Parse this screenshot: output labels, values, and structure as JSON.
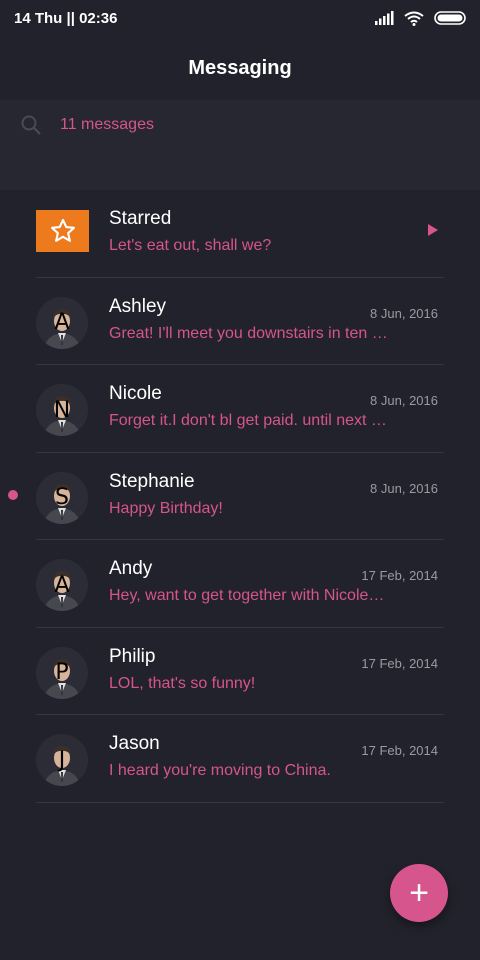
{
  "status_bar": {
    "time_text": "14 Thu || 02:36",
    "icons": [
      "signal-icon",
      "wifi-icon",
      "battery-icon"
    ]
  },
  "header": {
    "title": "Messaging"
  },
  "search": {
    "text": "11 messages",
    "icon": "search-icon"
  },
  "starred": {
    "name": "Starred",
    "preview": "Let's eat out, shall we?",
    "icon": "star-icon"
  },
  "conversations": [
    {
      "letter": "A",
      "name": "Ashley",
      "date": "8 Jun, 2016",
      "preview": "Great! I'll meet you downstairs in ten …",
      "unread": false
    },
    {
      "letter": "N",
      "name": "Nicole",
      "date": "8 Jun, 2016",
      "preview": "Forget it.I don't bl get paid. until next …",
      "unread": false
    },
    {
      "letter": "S",
      "name": "Stephanie",
      "date": "8 Jun, 2016",
      "preview": "Happy Birthday!",
      "unread": true
    },
    {
      "letter": "A",
      "name": "Andy",
      "date": "17 Feb, 2014",
      "preview": "Hey, want to get together with Nicole…",
      "unread": false
    },
    {
      "letter": "P",
      "name": "Philip",
      "date": "17 Feb, 2014",
      "preview": "LOL, that's so funny!",
      "unread": false
    },
    {
      "letter": "J",
      "name": "Jason",
      "date": "17 Feb, 2014",
      "preview": "I heard you're moving to China.",
      "unread": false
    }
  ],
  "fab": {
    "label": "+",
    "icon": "plus-icon"
  },
  "colors": {
    "background": "#22222c",
    "accent": "#d5558c",
    "starred_badge": "#ee7a1e",
    "date_text": "#9a9aa2"
  }
}
